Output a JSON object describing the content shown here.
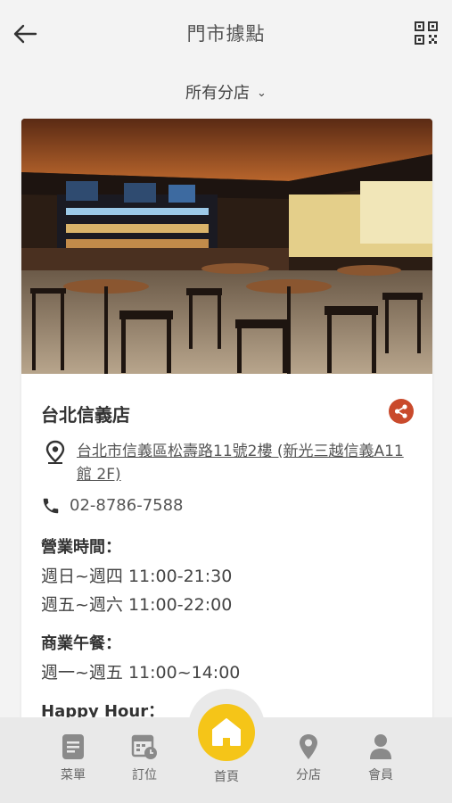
{
  "header": {
    "title": "門市據點"
  },
  "filter": {
    "label": "所有分店"
  },
  "store": {
    "name": "台北信義店",
    "address": "台北市信義區松壽路11號2樓 (新光三越信義A11館 2F)",
    "phone": "02-8786-7588",
    "hours_label": "營業時間：",
    "hours": [
      "週日~週四 11:00-21:30",
      "週五~週六 11:00-22:00"
    ],
    "lunch_label": "商業午餐：",
    "lunch": [
      "週一~週五 11:00~14:00"
    ],
    "happy_hour_label": "Happy Hour："
  },
  "tabs": {
    "menu": "菜單",
    "booking": "訂位",
    "home": "首頁",
    "stores": "分店",
    "member": "會員"
  },
  "colors": {
    "share": "#c94a2c",
    "home": "#f5c518",
    "icon": "#8a8a8a"
  }
}
